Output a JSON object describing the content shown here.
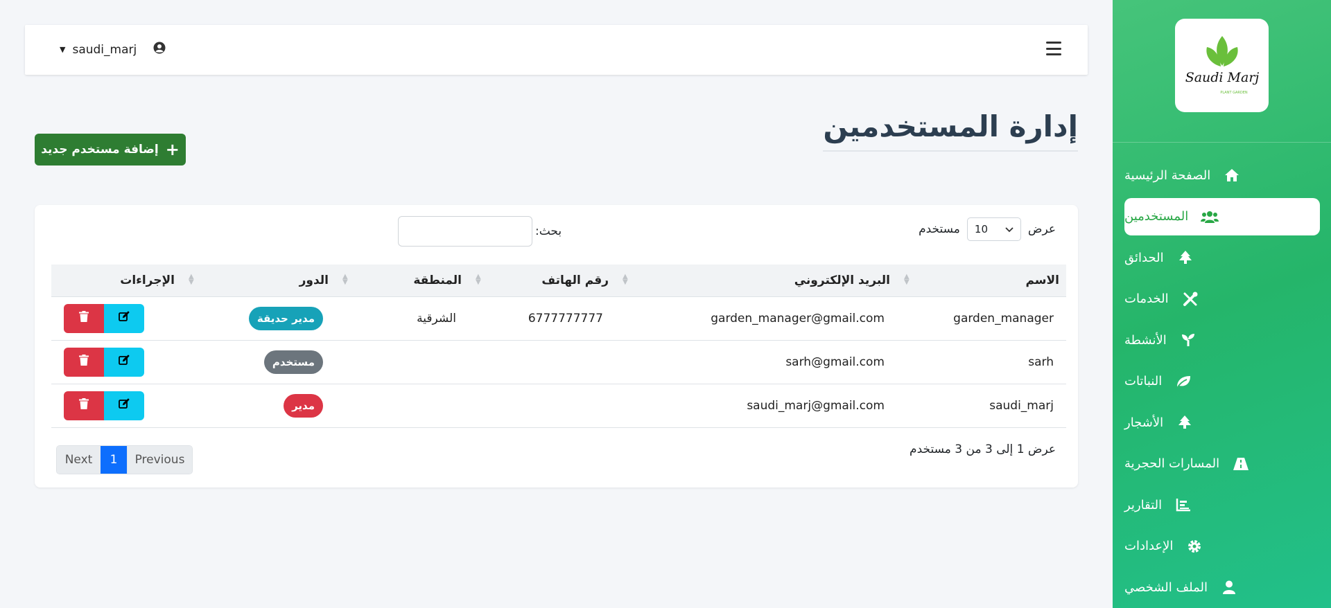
{
  "header": {
    "username": "saudi_marj",
    "user_icon": "user-circle-icon",
    "menu_icon": "hamburger-icon"
  },
  "sidebar": {
    "logo_text": "Saudi Marj",
    "logo_subtext": "PLANT GARDEN",
    "items": [
      {
        "label": "الصفحة الرئيسية",
        "icon": "home-icon",
        "active": false
      },
      {
        "label": "المستخدمين",
        "icon": "users-icon",
        "active": true
      },
      {
        "label": "الحدائق",
        "icon": "tree-icon",
        "active": false
      },
      {
        "label": "الخدمات",
        "icon": "tools-icon",
        "active": false
      },
      {
        "label": "الأنشطة",
        "icon": "seedling-icon",
        "active": false
      },
      {
        "label": "النباتات",
        "icon": "leaf-icon",
        "active": false
      },
      {
        "label": "الأشجار",
        "icon": "tree-icon",
        "active": false
      },
      {
        "label": "المسارات الحجرية",
        "icon": "road-icon",
        "active": false
      },
      {
        "label": "التقارير",
        "icon": "chart-icon",
        "active": false
      },
      {
        "label": "الإعدادات",
        "icon": "gear-icon",
        "active": false
      },
      {
        "label": "الملف الشخصي",
        "icon": "user-icon",
        "active": false
      }
    ]
  },
  "page": {
    "title": "إدارة المستخدمين",
    "add_button": "إضافة مستخدم جديد"
  },
  "table_controls": {
    "show_label": "عرض",
    "page_size": "10",
    "entries_label": "مستخدم",
    "search_label": "بحث:",
    "search_value": ""
  },
  "table": {
    "columns": [
      "الاسم",
      "البريد الإلكتروني",
      "رقم الهاتف",
      "المنطقة",
      "الدور",
      "الإجراءات"
    ],
    "rows": [
      {
        "name": "garden_manager",
        "email": "garden_manager@gmail.com",
        "phone": "6777777777",
        "region": "الشرقية",
        "role": "مدير حديقة",
        "role_color": "#17a2b8"
      },
      {
        "name": "sarh",
        "email": "sarh@gmail.com",
        "phone": "",
        "region": "",
        "role": "مستخدم",
        "role_color": "#6c757d"
      },
      {
        "name": "saudi_marj",
        "email": "saudi_marj@gmail.com",
        "phone": "",
        "region": "",
        "role": "مدير",
        "role_color": "#dc3545"
      }
    ]
  },
  "footer": {
    "info": "عرض 1 إلى 3 من 3 مستخدم",
    "previous": "Previous",
    "current_page": "1",
    "next": "Next"
  },
  "colors": {
    "sidebar": "#2eb86c",
    "add_button": "#2e7d32",
    "edit_button": "#0dcaf0",
    "delete_button": "#dc3545",
    "pager_active": "#0d6efd"
  }
}
